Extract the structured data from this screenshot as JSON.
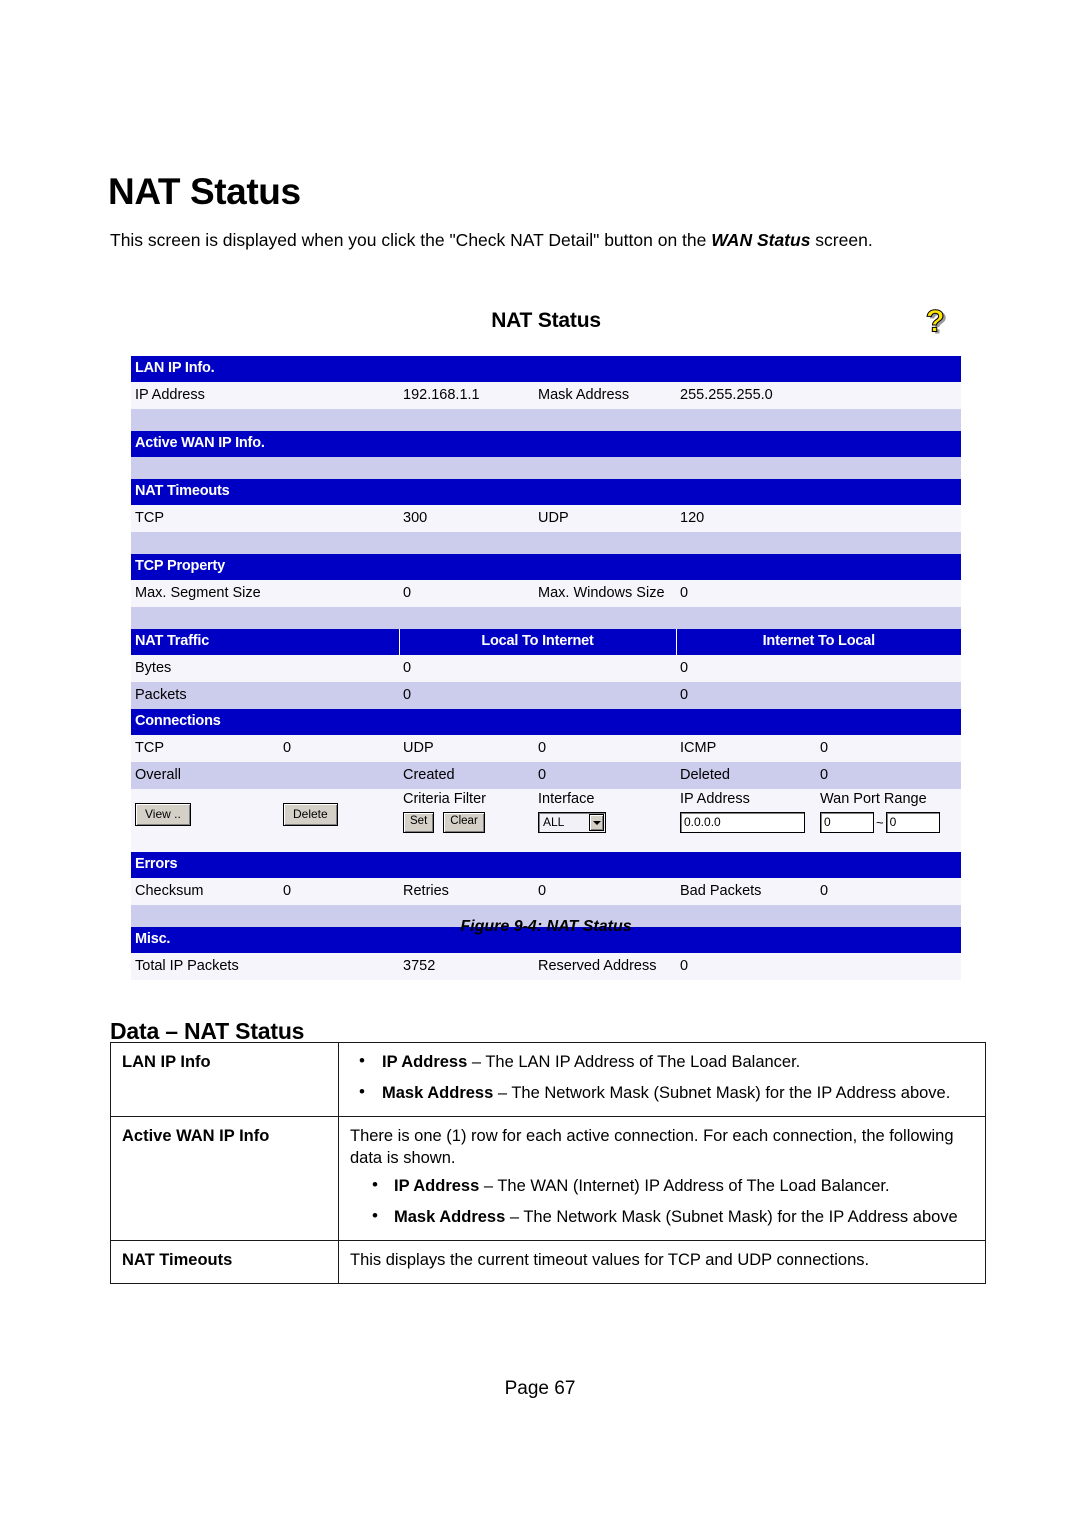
{
  "document": {
    "title": "NAT Status",
    "intro_prefix": "This screen is displayed when you click the \"Check NAT Detail\" button on the ",
    "intro_bold": "WAN Status",
    "intro_suffix": " screen.",
    "figure_caption": "Figure 9-4: NAT Status",
    "data_section_title": "Data – NAT Status",
    "page_number": "Page 67"
  },
  "screenshot": {
    "title": "NAT Status",
    "help_icon": "question-mark-help-icon",
    "sections": {
      "lan_ip_info": {
        "header": "LAN IP Info.",
        "label1": "IP Address",
        "value1": "192.168.1.1",
        "label2": "Mask Address",
        "value2": "255.255.255.0"
      },
      "active_wan_ip_info": {
        "header": "Active WAN IP Info."
      },
      "nat_timeouts": {
        "header": "NAT Timeouts",
        "label1": "TCP",
        "value1": "300",
        "label2": "UDP",
        "value2": "120"
      },
      "tcp_property": {
        "header": "TCP Property",
        "label1": "Max. Segment Size",
        "value1": "0",
        "label2": "Max. Windows Size",
        "value2": "0"
      },
      "nat_traffic": {
        "header": "NAT Traffic",
        "col_local_to_internet": "Local To Internet",
        "col_internet_to_local": "Internet To Local",
        "rows": [
          {
            "label": "Bytes",
            "local": "0",
            "internet": "0"
          },
          {
            "label": "Packets",
            "local": "0",
            "internet": "0"
          }
        ]
      },
      "connections": {
        "header": "Connections",
        "tcp_label": "TCP",
        "tcp_value": "0",
        "udp_label": "UDP",
        "udp_value": "0",
        "icmp_label": "ICMP",
        "icmp_value": "0",
        "overall_label": "Overall",
        "created_label": "Created",
        "created_value": "0",
        "deleted_label": "Deleted",
        "deleted_value": "0",
        "view_button": "View ..",
        "delete_button": "Delete",
        "criteria_filter_label": "Criteria Filter",
        "set_button": "Set",
        "clear_button": "Clear",
        "interface_label": "Interface",
        "interface_value": "ALL",
        "ip_address_label": "IP Address",
        "ip_address_value": "0.0.0.0",
        "wan_port_range_label": "Wan Port Range",
        "wan_port_from": "0",
        "wan_port_sep": "~",
        "wan_port_to": "0"
      },
      "errors": {
        "header": "Errors",
        "label1": "Checksum",
        "value1": "0",
        "label2": "Retries",
        "value2": "0",
        "label3": "Bad Packets",
        "value3": "0"
      },
      "misc": {
        "header": "Misc.",
        "label1": "Total IP Packets",
        "value1": "3752",
        "label2": "Reserved Address",
        "value2": "0"
      }
    }
  },
  "data_table": {
    "rows": [
      {
        "term": "LAN IP Info",
        "intro": "",
        "bullets": [
          {
            "bold": "IP Address",
            "text": " – The LAN IP Address of The Load Balancer."
          },
          {
            "bold": "Mask Address",
            "text": " – The Network Mask (Subnet Mask) for the IP Address above."
          }
        ]
      },
      {
        "term": "Active WAN IP Info",
        "intro": "There is one (1) row for each active connection. For each connection, the following data is shown.",
        "bullets": [
          {
            "bold": "IP Address",
            "text": " – The WAN (Internet) IP Address of The Load Balancer."
          },
          {
            "bold": "Mask Address",
            "text": " – The Network Mask (Subnet Mask) for the IP Address above"
          }
        ]
      },
      {
        "term": "NAT Timeouts",
        "intro": "This displays the current timeout values for TCP and UDP connections.",
        "bullets": []
      }
    ]
  },
  "colors": {
    "section_header_bg": "#0000c4",
    "row_white": "#f6f5fb",
    "row_lavender": "#ccccec",
    "help_icon_yellow": "#ffe400"
  }
}
